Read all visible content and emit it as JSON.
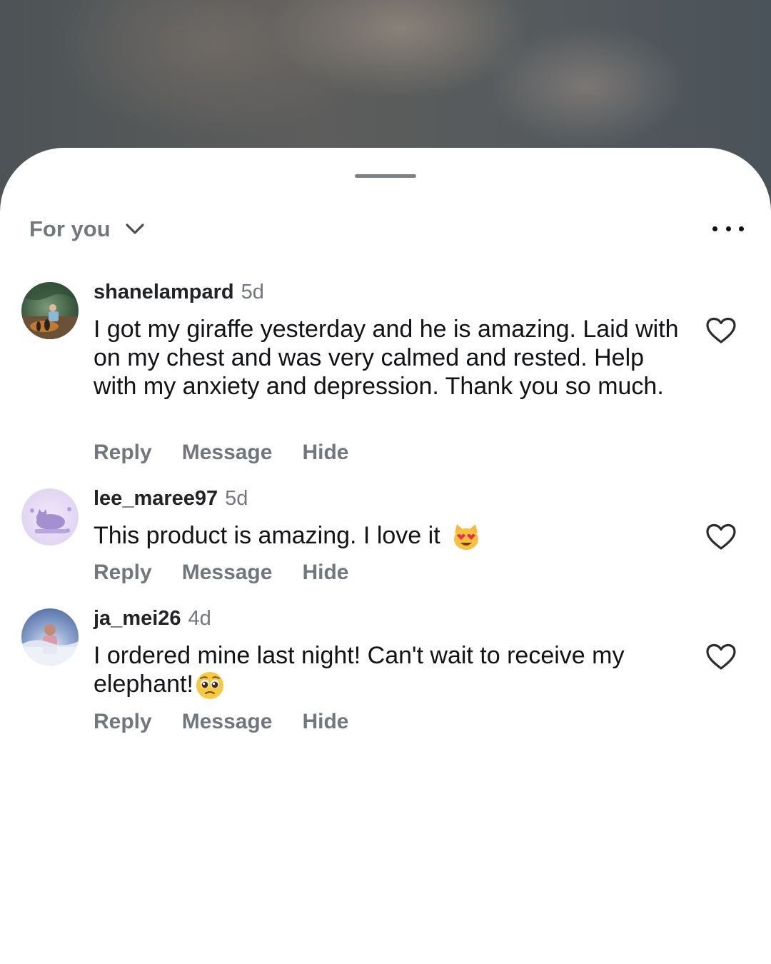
{
  "filter": {
    "label": "For you"
  },
  "comments": [
    {
      "username": "shanelampard",
      "time": "5d",
      "text": "I got my giraffe yesterday and he is amazing. Laid with on my chest and was very calmed and rested. Help with my anxiety and depression. Thank you so much.",
      "actions": {
        "reply": "Reply",
        "message": "Message",
        "hide": "Hide"
      }
    },
    {
      "username": "lee_maree97",
      "time": "5d",
      "text": "This product is amazing. I love it",
      "emoji": "heart-eyes-cat",
      "actions": {
        "reply": "Reply",
        "message": "Message",
        "hide": "Hide"
      }
    },
    {
      "username": "ja_mei26",
      "time": "4d",
      "text": "I ordered mine last night! Can't wait to receive my elephant!",
      "emoji": "pleading-face",
      "actions": {
        "reply": "Reply",
        "message": "Message",
        "hide": "Hide"
      }
    }
  ],
  "icons": {
    "filter_chevron": "chevron-down-icon",
    "more": "more-options-icon",
    "like": "heart-outline-icon"
  }
}
